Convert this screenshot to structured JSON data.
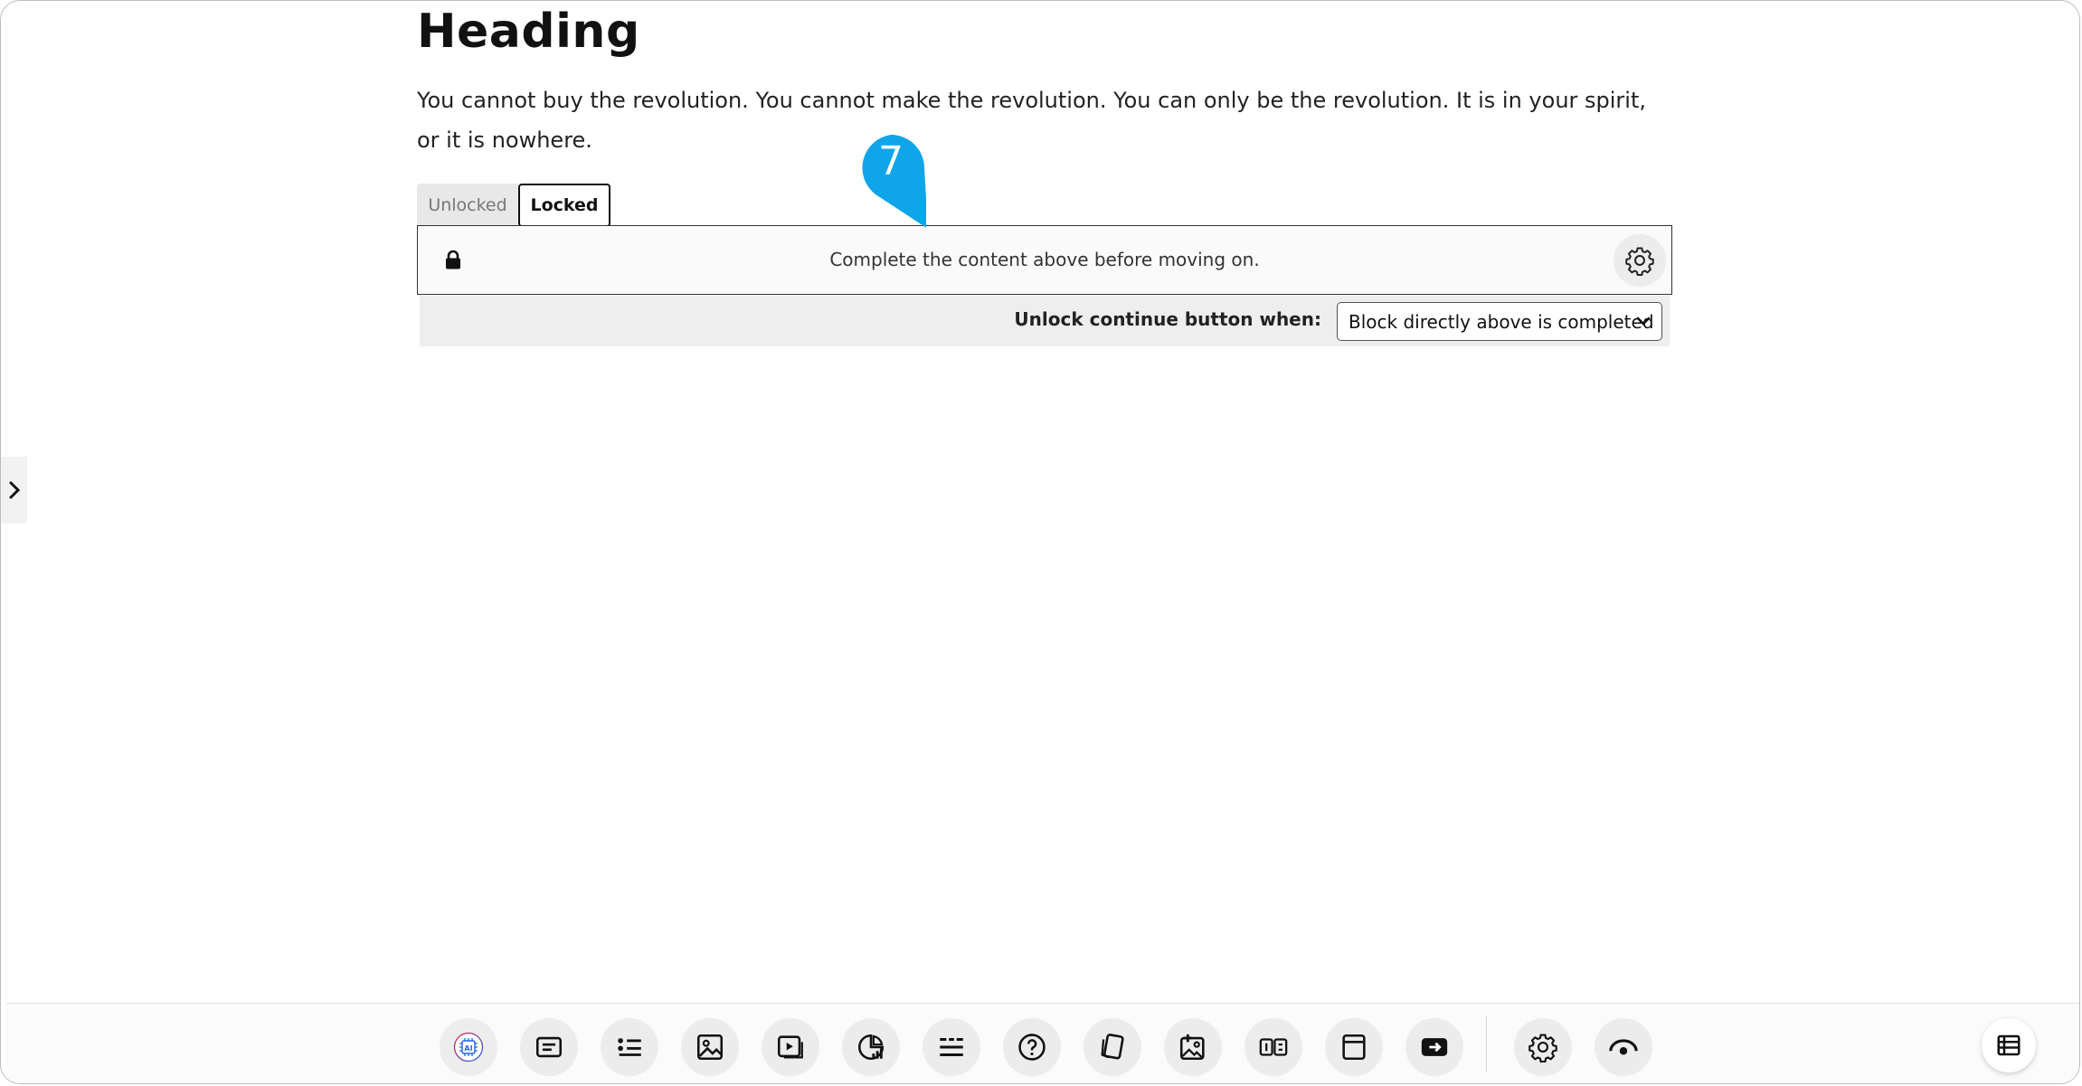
{
  "page": {
    "heading": "Heading",
    "paragraph": "You cannot buy the revolution. You cannot make the revolution. You can only be the revolution. It is in your spirit, or it is nowhere."
  },
  "tabs": [
    {
      "label": "Unlocked",
      "active": false
    },
    {
      "label": "Locked",
      "active": true
    }
  ],
  "lock_block": {
    "message": "Complete the content above before moving on.",
    "lock_icon": "lock-icon",
    "settings_icon": "gear-icon"
  },
  "unlock_bar": {
    "label": "Unlock continue button when:",
    "selected": "Block directly above is completed"
  },
  "callout": {
    "number": "7",
    "color": "#0ea5e9"
  },
  "toolbar": {
    "tools": [
      {
        "icon": "ai-chip-icon"
      },
      {
        "icon": "text-block-icon"
      },
      {
        "icon": "list-icon"
      },
      {
        "icon": "image-icon"
      },
      {
        "icon": "video-icon"
      },
      {
        "icon": "chart-icon"
      },
      {
        "icon": "divider-icon"
      },
      {
        "icon": "question-icon"
      },
      {
        "icon": "flashcard-icon"
      },
      {
        "icon": "add-image-icon"
      },
      {
        "icon": "compare-icon"
      },
      {
        "icon": "window-icon"
      },
      {
        "icon": "continue-icon"
      },
      {
        "icon": "gear-icon"
      },
      {
        "icon": "preview-eye-icon"
      },
      {
        "icon": "outline-list-icon"
      }
    ]
  }
}
